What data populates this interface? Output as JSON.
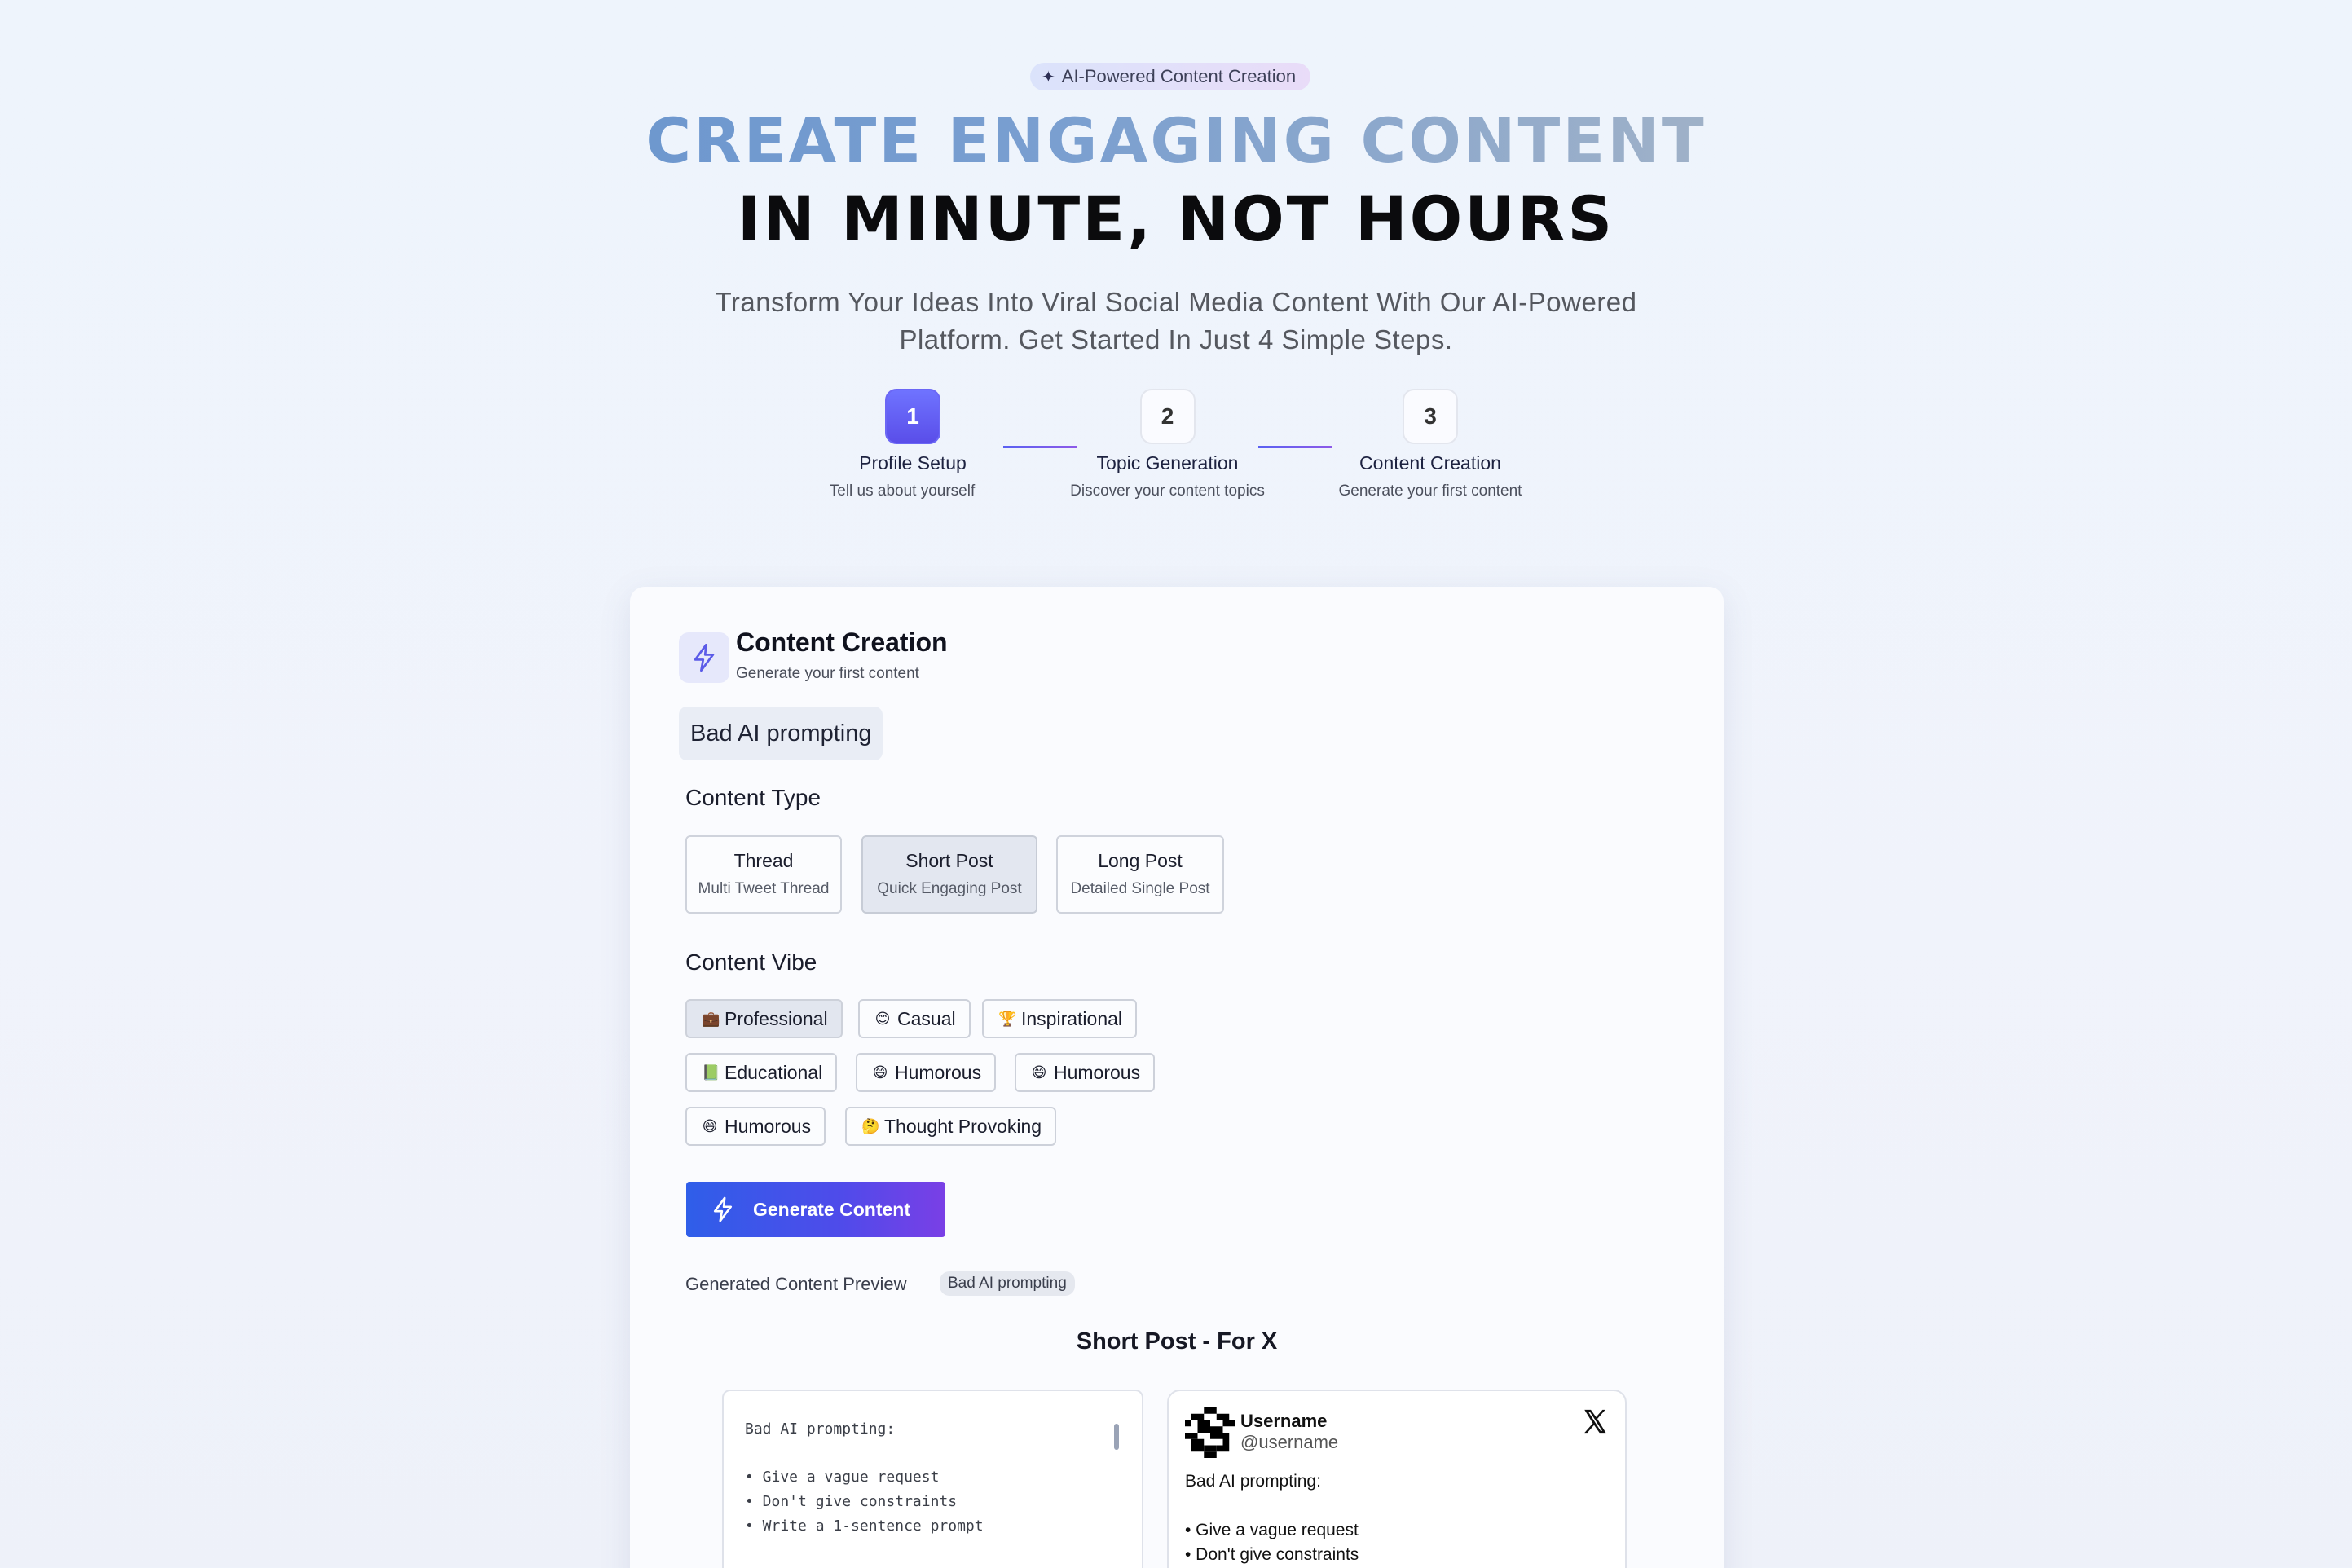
{
  "header": {
    "badge": "AI-Powered Content Creation",
    "headline_line1": "CREATE ENGAGING CONTENT",
    "headline_line2": "IN MINUTE, NOT HOURS",
    "subtitle": "Transform Your Ideas Into Viral Social Media Content With Our AI-Powered Platform. Get Started In Just 4 Simple Steps."
  },
  "steps": [
    {
      "number": "1",
      "title": "Profile Setup",
      "description": "Tell us about yourself",
      "active": true
    },
    {
      "number": "2",
      "title": "Topic Generation",
      "description": "Discover your content topics",
      "active": false
    },
    {
      "number": "3",
      "title": "Content Creation",
      "description": "Generate your first content",
      "active": false
    }
  ],
  "card": {
    "title": "Content Creation",
    "subtitle": "Generate your first content",
    "topic_tag": "Bad AI prompting",
    "content_type_label": "Content Type",
    "content_types": [
      {
        "title": "Thread",
        "subtitle": "Multi Tweet Thread",
        "selected": false
      },
      {
        "title": "Short Post",
        "subtitle": "Quick Engaging Post",
        "selected": true
      },
      {
        "title": "Long Post",
        "subtitle": "Detailed Single Post",
        "selected": false
      }
    ],
    "content_vibe_label": "Content Vibe",
    "vibes": [
      {
        "emoji": "💼",
        "label": "Professional",
        "selected": true
      },
      {
        "emoji": "😊",
        "label": "Casual",
        "selected": false
      },
      {
        "emoji": "🏆",
        "label": "Inspirational",
        "selected": false
      },
      {
        "emoji": "📗",
        "label": "Educational",
        "selected": false
      },
      {
        "emoji": "😄",
        "label": "Humorous",
        "selected": false
      },
      {
        "emoji": "😄",
        "label": "Humorous",
        "selected": false
      },
      {
        "emoji": "😄",
        "label": "Humorous",
        "selected": false
      },
      {
        "emoji": "🤔",
        "label": "Thought Provoking",
        "selected": false
      }
    ],
    "generate_button": "Generate Content",
    "preview_label": "Generated Content Preview",
    "preview_tag": "Bad AI prompting",
    "preview_title": "Short Post - For X"
  },
  "editor": {
    "heading": "Bad AI prompting:",
    "lines": [
      "• Give a vague request",
      "• Don't give constraints",
      "• Write a 1-sentence prompt"
    ]
  },
  "tweet": {
    "username": "Username",
    "handle": "@username",
    "heading": "Bad AI prompting:",
    "lines": [
      "• Give a vague request",
      "• Don't give constraints"
    ]
  },
  "colors": {
    "accent": "#5a4ee9",
    "button_start": "#2f5ee9",
    "button_end": "#7a3fe6"
  }
}
